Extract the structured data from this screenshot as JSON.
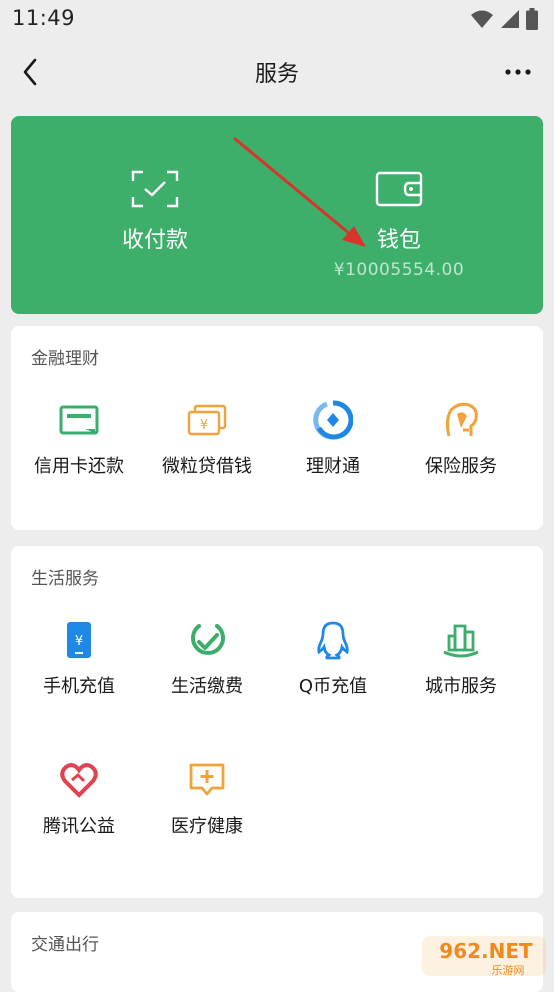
{
  "status_bar": {
    "time": "11:49",
    "icons": [
      "wifi-icon",
      "signal-icon",
      "battery-icon"
    ]
  },
  "nav": {
    "title": "服务",
    "back_icon": "back-chevron-icon",
    "more_icon": "more-dots-icon"
  },
  "wallet_card": {
    "color": "#3daf6a",
    "pay": {
      "label": "收付款",
      "icon": "scan-pay-icon"
    },
    "wallet": {
      "label": "钱包",
      "balance": "¥10005554.00",
      "icon": "wallet-icon"
    },
    "annotation_arrow_color": "#d9342b"
  },
  "finance": {
    "title": "金融理财",
    "items": [
      {
        "label": "信用卡还款",
        "icon": "credit-card-icon"
      },
      {
        "label": "微粒贷借钱",
        "icon": "loan-icon"
      },
      {
        "label": "理财通",
        "icon": "wealth-icon"
      },
      {
        "label": "保险服务",
        "icon": "insurance-icon"
      }
    ]
  },
  "life": {
    "title": "生活服务",
    "items": [
      {
        "label": "手机充值",
        "icon": "phone-recharge-icon"
      },
      {
        "label": "生活缴费",
        "icon": "utility-payment-icon"
      },
      {
        "label": "Q币充值",
        "icon": "qq-coin-icon"
      },
      {
        "label": "城市服务",
        "icon": "city-service-icon"
      },
      {
        "label": "腾讯公益",
        "icon": "charity-icon"
      },
      {
        "label": "医疗健康",
        "icon": "medical-icon"
      }
    ]
  },
  "transport": {
    "title": "交通出行"
  },
  "watermark": {
    "text": "962.NET",
    "subtext": "乐游网"
  }
}
